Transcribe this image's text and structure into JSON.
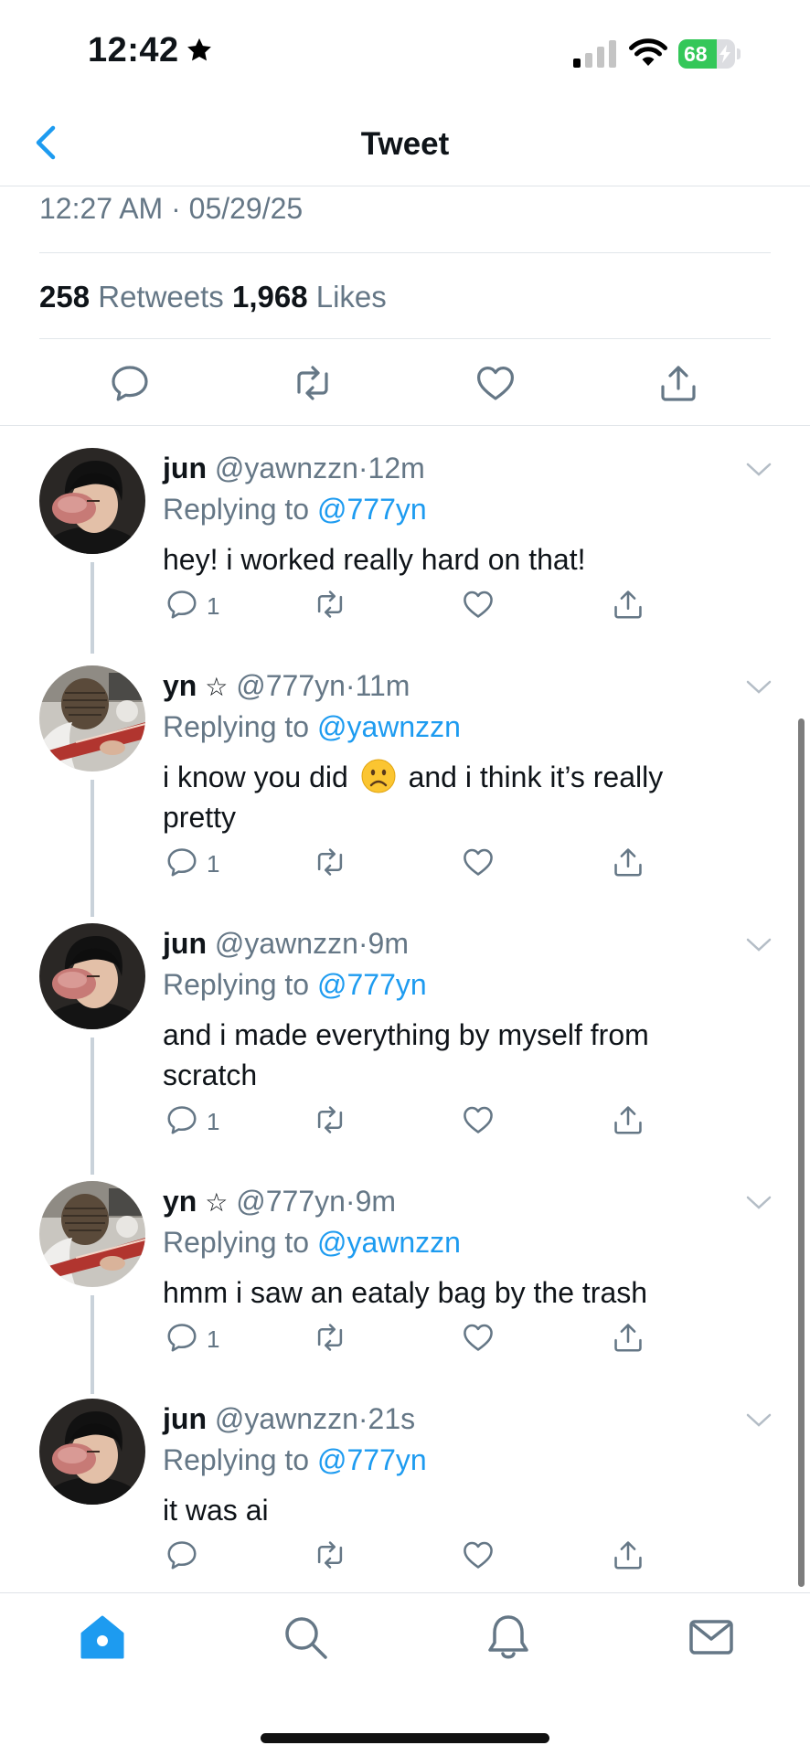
{
  "status_bar": {
    "time": "12:42",
    "battery": "68",
    "battery_level": 0.68
  },
  "header": {
    "title": "Tweet"
  },
  "tweet": {
    "timestamp": "12:27 AM · 05/29/25",
    "retweets_count": "258",
    "retweets_label": "Retweets",
    "likes_count": "1,968",
    "likes_label": "Likes"
  },
  "replies": [
    {
      "name": "jun",
      "star": "",
      "handle": "@yawnzzn",
      "time": "12m",
      "replying_prefix": "Replying to",
      "replying_to": "@777yn",
      "text": "hey! i worked really hard on that!",
      "reply_count": "1"
    },
    {
      "name": "yn",
      "star": "☆",
      "handle": "@777yn",
      "time": "11m",
      "replying_prefix": "Replying to",
      "replying_to": "@yawnzzn",
      "text_before_emoji": "i know you did",
      "emoji": "frowning-face",
      "text_after_emoji": "and i think it’s really pretty",
      "reply_count": "1"
    },
    {
      "name": "jun",
      "star": "",
      "handle": "@yawnzzn",
      "time": "9m",
      "replying_prefix": "Replying to",
      "replying_to": "@777yn",
      "text": "and i made everything by myself from scratch",
      "reply_count": "1"
    },
    {
      "name": "yn",
      "star": "☆",
      "handle": "@777yn",
      "time": "9m",
      "replying_prefix": "Replying to",
      "replying_to": "@yawnzzn",
      "text": "hmm i saw an eataly bag by the trash",
      "reply_count": "1"
    },
    {
      "name": "jun",
      "star": "",
      "handle": "@yawnzzn",
      "time": "21s",
      "replying_prefix": "Replying to",
      "replying_to": "@777yn",
      "text": "it was ai",
      "reply_count": ""
    }
  ],
  "tab_bar": {
    "active_tab": "home"
  },
  "colors": {
    "accent": "#1d9bf0",
    "secondary_text": "#657786",
    "battery_green": "#34c759"
  }
}
